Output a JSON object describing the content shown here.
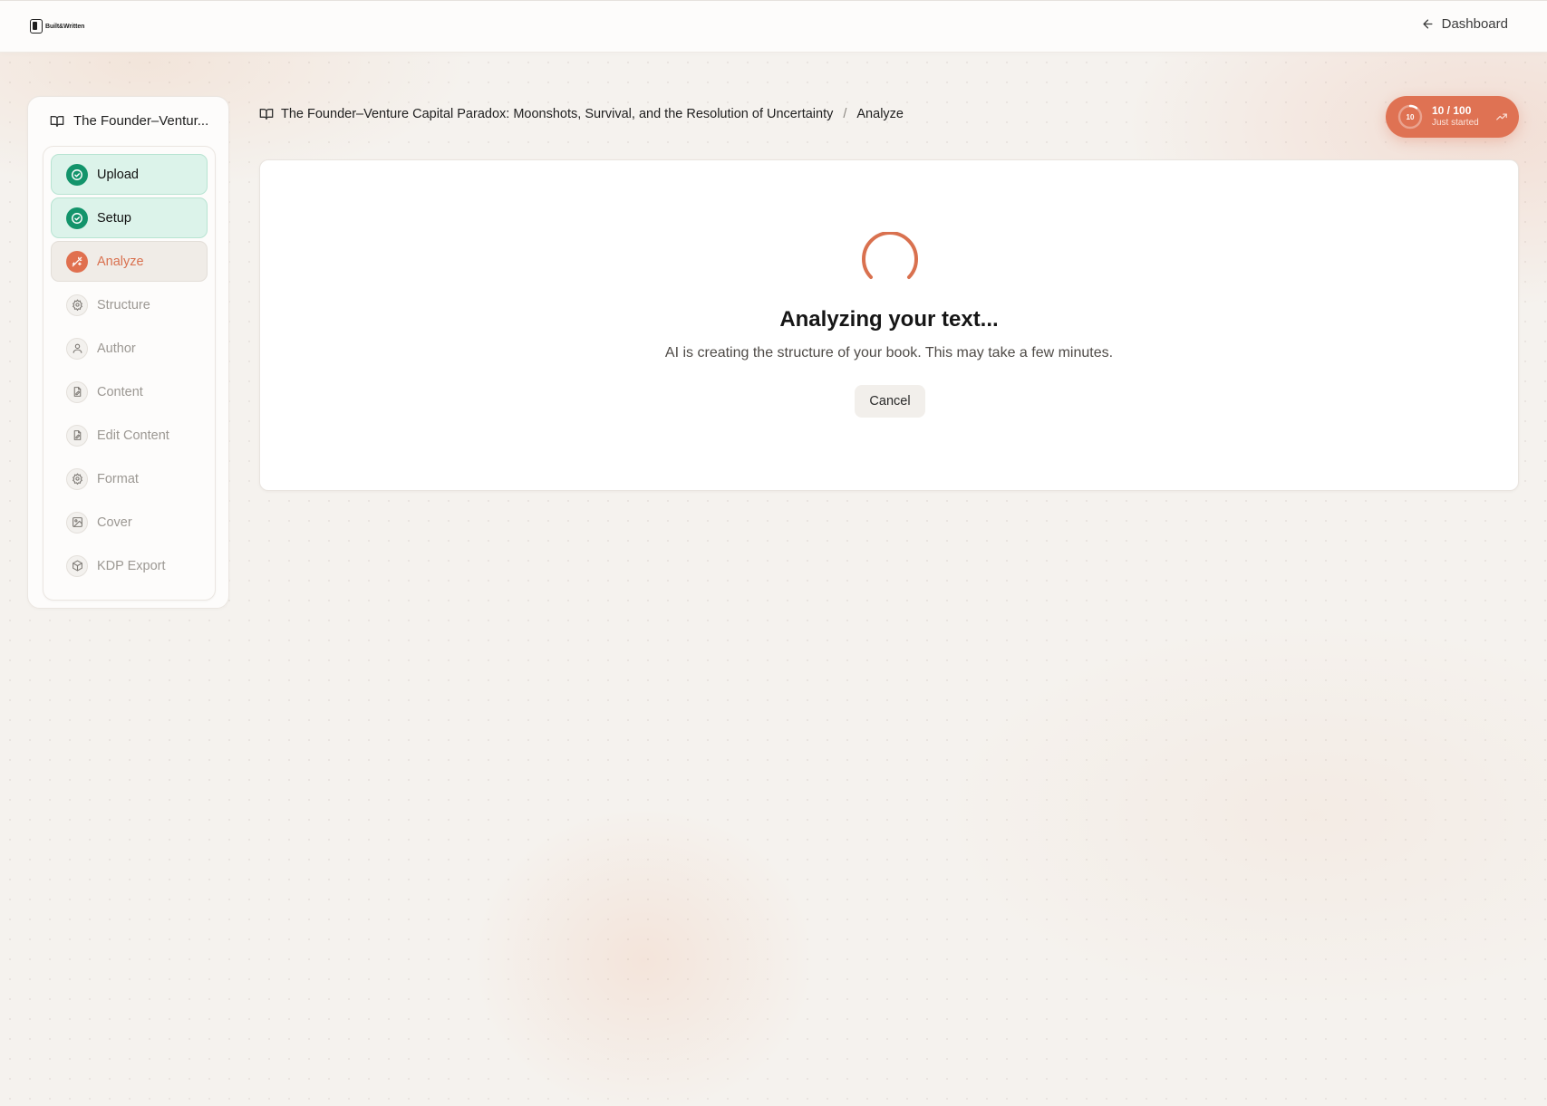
{
  "app": {
    "logo_text": "Built&Written"
  },
  "header": {
    "back_label": "Dashboard"
  },
  "sidebar": {
    "project_title": "The Founder–Ventur...",
    "steps": [
      {
        "label": "Upload",
        "status": "done"
      },
      {
        "label": "Setup",
        "status": "done"
      },
      {
        "label": "Analyze",
        "status": "active"
      },
      {
        "label": "Structure",
        "status": "todo"
      },
      {
        "label": "Author",
        "status": "todo"
      },
      {
        "label": "Content",
        "status": "todo"
      },
      {
        "label": "Edit Content",
        "status": "todo"
      },
      {
        "label": "Format",
        "status": "todo"
      },
      {
        "label": "Cover",
        "status": "todo"
      },
      {
        "label": "KDP Export",
        "status": "todo"
      }
    ]
  },
  "breadcrumb": {
    "project": "The Founder–Venture Capital Paradox: Moonshots, Survival, and the Resolution of Uncertainty",
    "separator": "/",
    "current": "Analyze"
  },
  "progress_badge": {
    "ring_value": "10",
    "score": "10 / 100",
    "subtitle": "Just started",
    "fraction": 0.1
  },
  "main": {
    "title": "Analyzing your text...",
    "description": "AI is creating the structure of your book. This may take a few minutes.",
    "cancel_label": "Cancel"
  },
  "colors": {
    "accent": "#df7253",
    "success": "#13946b",
    "success_bg": "#dcf3ea"
  }
}
